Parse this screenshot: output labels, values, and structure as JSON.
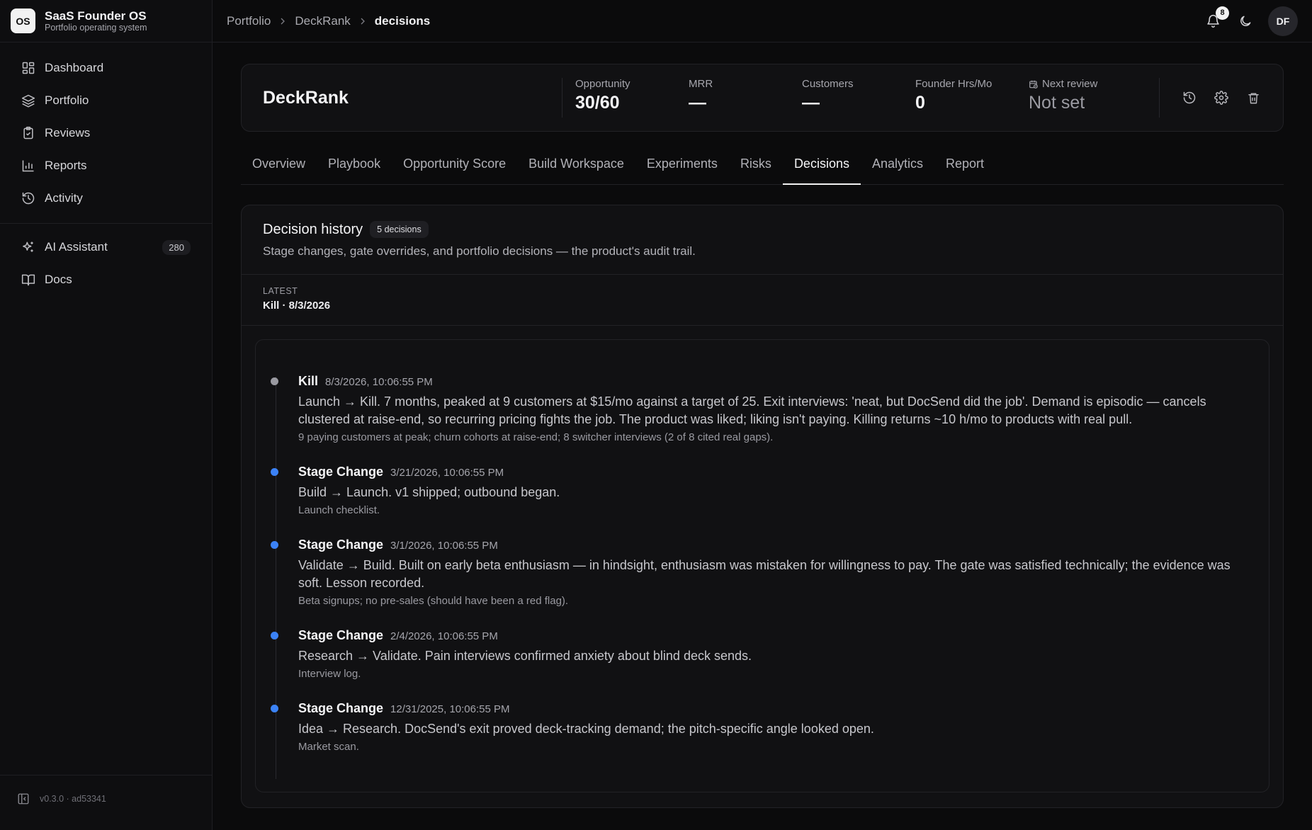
{
  "brand": {
    "logo": "OS",
    "name": "SaaS Founder OS",
    "subtitle": "Portfolio operating system"
  },
  "sidebar": {
    "items": [
      {
        "label": "Dashboard",
        "icon": "dashboard-icon"
      },
      {
        "label": "Portfolio",
        "icon": "layers-icon"
      },
      {
        "label": "Reviews",
        "icon": "clipboard-check-icon"
      },
      {
        "label": "Reports",
        "icon": "bar-chart-icon"
      },
      {
        "label": "Activity",
        "icon": "history-icon"
      }
    ],
    "secondary": [
      {
        "label": "AI Assistant",
        "icon": "sparkles-icon",
        "badge": "280"
      },
      {
        "label": "Docs",
        "icon": "book-icon"
      }
    ],
    "version": "v0.3.0 · ad53341"
  },
  "topbar": {
    "breadcrumb": [
      "Portfolio",
      "DeckRank",
      "decisions"
    ],
    "notification_count": "8",
    "avatar": "DF"
  },
  "product": {
    "name": "DeckRank",
    "stats": [
      {
        "label": "Opportunity",
        "value": "30/60"
      },
      {
        "label": "MRR",
        "value": "—"
      },
      {
        "label": "Customers",
        "value": "—"
      },
      {
        "label": "Founder Hrs/Mo",
        "value": "0"
      },
      {
        "label": "Next review",
        "value": "Not set"
      }
    ]
  },
  "tabs": [
    "Overview",
    "Playbook",
    "Opportunity Score",
    "Build Workspace",
    "Experiments",
    "Risks",
    "Decisions",
    "Analytics",
    "Report"
  ],
  "active_tab": "Decisions",
  "decisions": {
    "title": "Decision history",
    "count_badge": "5 decisions",
    "description": "Stage changes, gate overrides, and portfolio decisions — the product's audit trail.",
    "latest_label": "LATEST",
    "latest_value": "Kill · 8/3/2026",
    "entries": [
      {
        "type": "Kill",
        "date": "8/3/2026, 10:06:55 PM",
        "text": "Launch → Kill. 7 months, peaked at 9 customers at $15/mo against a target of 25. Exit interviews: 'neat, but DocSend did the job'. Demand is episodic — cancels clustered at raise-end, so recurring pricing fights the job. The product was liked; liking isn't paying. Killing returns ~10 h/mo to products with real pull.",
        "note": "9 paying customers at peak; churn cohorts at raise-end; 8 switcher interviews (2 of 8 cited real gaps)."
      },
      {
        "type": "Stage Change",
        "date": "3/21/2026, 10:06:55 PM",
        "text": "Build → Launch. v1 shipped; outbound began.",
        "note": "Launch checklist."
      },
      {
        "type": "Stage Change",
        "date": "3/1/2026, 10:06:55 PM",
        "text": "Validate → Build. Built on early beta enthusiasm — in hindsight, enthusiasm was mistaken for willingness to pay. The gate was satisfied technically; the evidence was soft. Lesson recorded.",
        "note": "Beta signups; no pre-sales (should have been a red flag)."
      },
      {
        "type": "Stage Change",
        "date": "2/4/2026, 10:06:55 PM",
        "text": "Research → Validate. Pain interviews confirmed anxiety about blind deck sends.",
        "note": "Interview log."
      },
      {
        "type": "Stage Change",
        "date": "12/31/2025, 10:06:55 PM",
        "text": "Idea → Research. DocSend's exit proved deck-tracking demand; the pitch-specific angle looked open.",
        "note": "Market scan."
      }
    ]
  },
  "colors": {
    "background": "#0b0b0c",
    "card": "#111113",
    "accent_dot": "#3b82f6",
    "kill_dot": "#9a9aa1"
  }
}
